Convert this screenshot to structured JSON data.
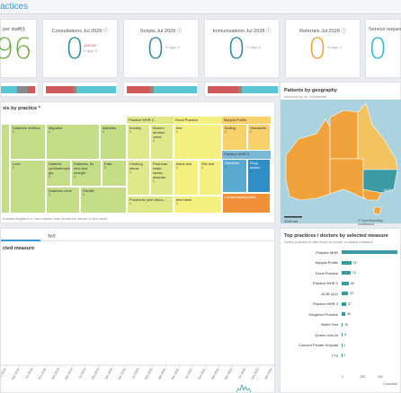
{
  "header": {
    "title": "actices"
  },
  "kpis": [
    {
      "title": "per staff(i)",
      "value": "96",
      "color": "#6dab45"
    },
    {
      "title": "Consultations Jul 2028 ⓘ",
      "value": "0",
      "color": "#2f8aa0",
      "delta": "-100.0%",
      "sub": "Yr ago: 0"
    },
    {
      "title": "Scripts Jul 2028 ⓘ",
      "value": "0",
      "color": "#2f8aa0",
      "sub": "Yr ago: 0"
    },
    {
      "title": "Immunisations Jul 2028 ⓘ",
      "value": "0",
      "color": "#2f8aa0",
      "sub": "Yr ago: 0"
    },
    {
      "title": "Referrals Jul 2028 ⓘ",
      "value": "0",
      "color": "#f0a33a",
      "sub": "Yr ago: 0"
    },
    {
      "title": "Service requests",
      "value": "0",
      "color": "#2bbccc"
    }
  ],
  "colors": {
    "accent": "#3c98d4",
    "teal": "#3a9ba5",
    "red": "#d05a5a",
    "cyan": "#59c6d4",
    "grey": "#8a8a8a"
  },
  "treemap": {
    "title": "sis by practice *",
    "footnote": "ontains negative or zero values that cannot be shown in this chart.",
    "cells": [
      {
        "label": "",
        "value": "",
        "bg": "#c4de88"
      },
      {
        "label": "Diabetes mellitus",
        "value": "1",
        "bg": "#c4de88"
      },
      {
        "label": "Migraine",
        "value": "1",
        "bg": "#c4de88"
      },
      {
        "label": "diabetes",
        "value": "1",
        "bg": "#c4de88"
      },
      {
        "label": "Love",
        "value": "1",
        "bg": "#c4de88"
      },
      {
        "label": "Diabetic ophthalmople gia",
        "value": "1",
        "bg": "#c4de88"
      },
      {
        "label": "Diabetes, flu shot and tubegirl.",
        "value": "1",
        "bg": "#c4de88"
      },
      {
        "label": "Falls",
        "value": "1",
        "bg": "#c4de88"
      },
      {
        "label": "Diabetes urine",
        "value": "1",
        "bg": "#c4de88"
      },
      {
        "label": "Fishfilit",
        "value": "1",
        "bg": "#c4de88"
      },
      {
        "label": "Practice MHR 2",
        "value": "",
        "bg": "#dfe98a"
      },
      {
        "label": "Anxiety",
        "value": "1",
        "bg": "#dfe98a"
      },
      {
        "label": "Broken denture chest",
        "value": "1",
        "bg": "#dfe98a"
      },
      {
        "label": "Choking elbow",
        "value": "1",
        "bg": "#dfe98a"
      },
      {
        "label": "Post-trau matic stress disorder",
        "value": "1",
        "bg": "#dfe98a"
      },
      {
        "label": "Prosthetic joint disloc...",
        "value": "1",
        "bg": "#dfe98a"
      },
      {
        "label": "Rural Practice",
        "value": "",
        "bg": "#f4f180"
      },
      {
        "label": "test",
        "value": "1",
        "bg": "#f4f180"
      },
      {
        "label": "blank test",
        "value": "1",
        "bg": "#f4f180"
      },
      {
        "label": "Skk test",
        "value": "1",
        "bg": "#f4f180"
      },
      {
        "label": "test blank",
        "value": "1",
        "bg": "#f4f180"
      },
      {
        "label": "Myopia Profile",
        "value": "",
        "bg": "#f7d16a"
      },
      {
        "label": "Bulling",
        "value": "1",
        "bg": "#f7d16a"
      },
      {
        "label": "Headache",
        "value": "1",
        "bg": "#f7d16a"
      },
      {
        "label": "Practice MHR 3",
        "value": "",
        "bg": "#7ab8d6"
      },
      {
        "label": "Otorrhea",
        "value": "1",
        "bg": "#5aa9d0"
      },
      {
        "label": "Drug addict",
        "value": "1",
        "bg": "#2f8fc6"
      },
      {
        "label": "Lauraanaplapestitis",
        "value": "",
        "bg": "#f2903a"
      }
    ]
  },
  "map": {
    "title": "Patients by geography",
    "subtitle": "coloured by no. of patients",
    "scale": "1000 km",
    "credit": "© OpenStreetMap contributors",
    "region_label": "ACT"
  },
  "line": {
    "tab1": "YoY",
    "title": "cted measure",
    "ticks": [
      "Jan 2018",
      "Apr 2018",
      "Jul 2018",
      "Oct 2018",
      "Jan 2019",
      "Apr 2019",
      "Jul 2019",
      "Oct 2019",
      "Jan 2020",
      "Apr 2020",
      "Jul 2020",
      "Oct 2020",
      "Jan 2021",
      "Apr 2021",
      "Jul 2021",
      "Oct 2021",
      "Jan 2022",
      "Apr 2022",
      "Jul 2022",
      "Oct 2022",
      "Jan 2023"
    ]
  },
  "top": {
    "title": "Top practices / doctors by selected measure",
    "subtitle": "Select practice to drill down to doctor or switch measure",
    "axis_title": "Consultati",
    "axis": [
      "0",
      "200",
      "400"
    ],
    "rows": [
      {
        "label": "Practice MHR",
        "value": "",
        "frac": 1.0
      },
      {
        "label": "Myopia Profile",
        "value": "78",
        "frac": 0.17
      },
      {
        "label": "Rural Practice",
        "value": "74",
        "frac": 0.16
      },
      {
        "label": "Practice MHR 2",
        "value": "60",
        "frac": 0.13
      },
      {
        "label": "ACIB QLD",
        "value": "57",
        "frac": 0.12
      },
      {
        "label": "Practice MHR 3",
        "value": "37",
        "frac": 0.08
      },
      {
        "label": "Kingsford Practice",
        "value": "30",
        "frac": 0.065
      },
      {
        "label": "Matt's Test",
        "value": "10",
        "frac": 0.022
      },
      {
        "label": "Queen how lol",
        "value": "9",
        "frac": 0.019
      },
      {
        "label": "Concord Private Hospital",
        "value": "1",
        "frac": 0.003
      },
      {
        "label": "TTS",
        "value": "1",
        "frac": 0.003
      }
    ]
  }
}
